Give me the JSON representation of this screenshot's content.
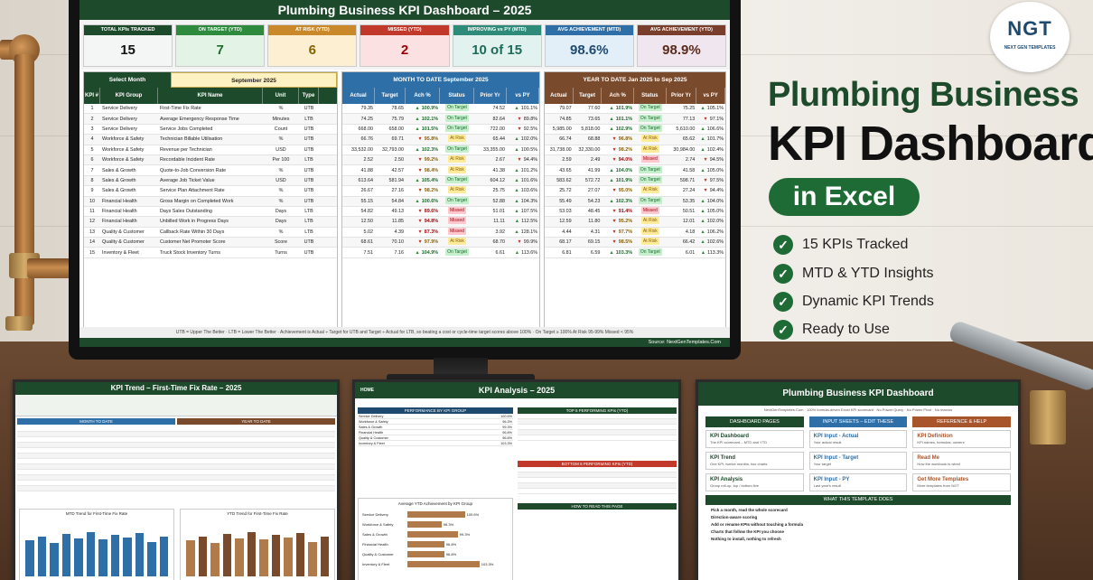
{
  "hero": {
    "line1": "Plumbing Business",
    "line2": "KPI Dashboard",
    "line3": "in Excel",
    "features": [
      "15 KPIs Tracked",
      "MTD & YTD Insights",
      "Dynamic KPI Trends",
      "Ready to Use"
    ]
  },
  "logo": {
    "mark": "NGT",
    "text": "NEXT GEN TEMPLATES"
  },
  "dashboard": {
    "title": "Plumbing Business KPI Dashboard  –  2025",
    "cards": [
      {
        "label": "TOTAL KPIs TRACKED",
        "value": "15",
        "head": "#1e4a2c",
        "bg": "#f3f6f4",
        "fg": "#111"
      },
      {
        "label": "ON TARGET (YTD)",
        "value": "7",
        "head": "#2e8b3e",
        "bg": "#e3f3e6",
        "fg": "#1e6b2d"
      },
      {
        "label": "AT RISK (YTD)",
        "value": "6",
        "head": "#c9892a",
        "bg": "#fdf0d2",
        "fg": "#8a6100"
      },
      {
        "label": "MISSED (YTD)",
        "value": "2",
        "head": "#c0392b",
        "bg": "#fbe1e1",
        "fg": "#9c0006"
      },
      {
        "label": "IMPROVING vs PY (MTD)",
        "value": "10 of 15",
        "head": "#2e8b7a",
        "bg": "#e2f2ee",
        "fg": "#1e6b5c"
      },
      {
        "label": "AVG ACHIEVEMENT (MTD)",
        "value": "98.6%",
        "head": "#2f6fa8",
        "bg": "#e2eef8",
        "fg": "#1e4a70"
      },
      {
        "label": "AVG ACHIEVEMENT (YTD)",
        "value": "98.9%",
        "head": "#7a3f2c",
        "bg": "#efe6ef",
        "fg": "#5a2a1a"
      }
    ],
    "select_month_label": "Select Month",
    "select_month_value": "September 2025",
    "mtd_header": "MONTH TO DATE   September 2025",
    "ytd_header": "YEAR TO DATE   Jan 2025  to  Sep 2025",
    "left_cols": [
      "KPI #",
      "KPI Group",
      "KPI Name",
      "Unit",
      "Type"
    ],
    "metric_cols": [
      "Actual",
      "Target",
      "Ach %",
      "Status",
      "Prior Yr",
      "vs PY"
    ],
    "rows": [
      {
        "n": "1",
        "g": "Service Delivery",
        "k": "First-Time Fix Rate",
        "u": "%",
        "t": "UTB",
        "m": [
          "79.35",
          "78.65",
          "100.9%",
          "On Target",
          "74.52",
          "101.1%"
        ],
        "ms": "on",
        "md": "up",
        "my": "up",
        "y": [
          "79.07",
          "77.60",
          "101.9%",
          "On Target",
          "75.25",
          "105.1%"
        ],
        "ys": "on",
        "yd": "up",
        "yy": "up"
      },
      {
        "n": "2",
        "g": "Service Delivery",
        "k": "Average Emergency Response Time",
        "u": "Minutes",
        "t": "LTB",
        "m": [
          "74.25",
          "75.79",
          "102.1%",
          "On Target",
          "82.64",
          "89.8%"
        ],
        "ms": "on",
        "md": "up",
        "my": "dn",
        "y": [
          "74.85",
          "73.65",
          "101.1%",
          "On Target",
          "77.13",
          "97.1%"
        ],
        "ys": "on",
        "yd": "up",
        "yy": "dn"
      },
      {
        "n": "3",
        "g": "Service Delivery",
        "k": "Service Jobs Completed",
        "u": "Count",
        "t": "UTB",
        "m": [
          "668.00",
          "658.00",
          "101.5%",
          "On Target",
          "722.00",
          "92.5%"
        ],
        "ms": "on",
        "md": "up",
        "my": "dn",
        "y": [
          "5,985.00",
          "5,818.00",
          "102.9%",
          "On Target",
          "5,610.00",
          "106.6%"
        ],
        "ys": "on",
        "yd": "up",
        "yy": "up"
      },
      {
        "n": "4",
        "g": "Workforce & Safety",
        "k": "Technician Billable Utilisation",
        "u": "%",
        "t": "UTB",
        "m": [
          "66.76",
          "69.71",
          "95.8%",
          "At Risk",
          "65.44",
          "102.0%"
        ],
        "ms": "risk",
        "md": "dn",
        "my": "up",
        "y": [
          "66.74",
          "68.88",
          "96.8%",
          "At Risk",
          "65.62",
          "101.7%"
        ],
        "ys": "risk",
        "yd": "dn",
        "yy": "up"
      },
      {
        "n": "5",
        "g": "Workforce & Safety",
        "k": "Revenue per Technician",
        "u": "USD",
        "t": "UTB",
        "m": [
          "33,532.00",
          "32,793.00",
          "102.3%",
          "On Target",
          "33,355.00",
          "100.5%"
        ],
        "ms": "on",
        "md": "up",
        "my": "up",
        "y": [
          "31,738.00",
          "32,330.00",
          "98.2%",
          "At Risk",
          "30,984.00",
          "102.4%"
        ],
        "ys": "risk",
        "yd": "dn",
        "yy": "up"
      },
      {
        "n": "6",
        "g": "Workforce & Safety",
        "k": "Recordable Incident Rate",
        "u": "Per 100",
        "t": "LTB",
        "m": [
          "2.52",
          "2.50",
          "99.2%",
          "At Risk",
          "2.67",
          "94.4%"
        ],
        "ms": "risk",
        "md": "dn",
        "my": "dn",
        "y": [
          "2.59",
          "2.49",
          "94.0%",
          "Missed",
          "2.74",
          "94.5%"
        ],
        "ys": "miss",
        "yd": "dn",
        "yy": "dn"
      },
      {
        "n": "7",
        "g": "Sales & Growth",
        "k": "Quote-to-Job Conversion Rate",
        "u": "%",
        "t": "UTB",
        "m": [
          "41.88",
          "42.57",
          "98.4%",
          "At Risk",
          "41.38",
          "101.2%"
        ],
        "ms": "risk",
        "md": "dn",
        "my": "up",
        "y": [
          "43.65",
          "41.99",
          "104.0%",
          "On Target",
          "41.58",
          "105.0%"
        ],
        "ys": "on",
        "yd": "up",
        "yy": "up"
      },
      {
        "n": "8",
        "g": "Sales & Growth",
        "k": "Average Job Ticket Value",
        "u": "USD",
        "t": "UTB",
        "m": [
          "613.64",
          "581.94",
          "105.4%",
          "On Target",
          "604.12",
          "101.6%"
        ],
        "ms": "on",
        "md": "up",
        "my": "up",
        "y": [
          "583.62",
          "572.72",
          "101.9%",
          "On Target",
          "598.71",
          "97.5%"
        ],
        "ys": "on",
        "yd": "up",
        "yy": "dn"
      },
      {
        "n": "9",
        "g": "Sales & Growth",
        "k": "Service Plan Attachment Rate",
        "u": "%",
        "t": "UTB",
        "m": [
          "26.67",
          "27.16",
          "98.2%",
          "At Risk",
          "25.75",
          "103.6%"
        ],
        "ms": "risk",
        "md": "dn",
        "my": "up",
        "y": [
          "25.72",
          "27.07",
          "95.0%",
          "At Risk",
          "27.24",
          "94.4%"
        ],
        "ys": "risk",
        "yd": "dn",
        "yy": "dn"
      },
      {
        "n": "10",
        "g": "Financial Health",
        "k": "Gross Margin on Completed Work",
        "u": "%",
        "t": "UTB",
        "m": [
          "55.15",
          "54.84",
          "100.6%",
          "On Target",
          "52.88",
          "104.3%"
        ],
        "ms": "on",
        "md": "up",
        "my": "up",
        "y": [
          "55.49",
          "54.23",
          "102.3%",
          "On Target",
          "53.35",
          "104.0%"
        ],
        "ys": "on",
        "yd": "up",
        "yy": "up"
      },
      {
        "n": "11",
        "g": "Financial Health",
        "k": "Days Sales Outstanding",
        "u": "Days",
        "t": "LTB",
        "m": [
          "54.82",
          "49.13",
          "89.6%",
          "Missed",
          "51.01",
          "107.5%"
        ],
        "ms": "miss",
        "md": "dn",
        "my": "up",
        "y": [
          "53.03",
          "48.45",
          "91.4%",
          "Missed",
          "50.51",
          "105.0%"
        ],
        "ys": "miss",
        "yd": "dn",
        "yy": "up"
      },
      {
        "n": "12",
        "g": "Financial Health",
        "k": "Unbilled Work in Progress Days",
        "u": "Days",
        "t": "LTB",
        "m": [
          "12.50",
          "11.85",
          "94.8%",
          "Missed",
          "11.11",
          "112.5%"
        ],
        "ms": "miss",
        "md": "dn",
        "my": "up",
        "y": [
          "12.59",
          "11.80",
          "95.2%",
          "At Risk",
          "12.01",
          "102.0%"
        ],
        "ys": "risk",
        "yd": "dn",
        "yy": "up"
      },
      {
        "n": "13",
        "g": "Quality & Customer",
        "k": "Callback Rate Within 30 Days",
        "u": "%",
        "t": "LTB",
        "m": [
          "5.02",
          "4.39",
          "87.3%",
          "Missed",
          "3.92",
          "128.1%"
        ],
        "ms": "miss",
        "md": "dn",
        "my": "up",
        "y": [
          "4.44",
          "4.31",
          "97.7%",
          "At Risk",
          "4.18",
          "106.2%"
        ],
        "ys": "risk",
        "yd": "dn",
        "yy": "up"
      },
      {
        "n": "14",
        "g": "Quality & Customer",
        "k": "Customer Net Promoter Score",
        "u": "Score",
        "t": "UTB",
        "m": [
          "68.61",
          "70.10",
          "97.9%",
          "At Risk",
          "68.70",
          "99.9%"
        ],
        "ms": "risk",
        "md": "dn",
        "my": "dn",
        "y": [
          "68.17",
          "69.15",
          "98.5%",
          "At Risk",
          "66.42",
          "102.6%"
        ],
        "ys": "risk",
        "yd": "dn",
        "yy": "up"
      },
      {
        "n": "15",
        "g": "Inventory & Fleet",
        "k": "Truck Stock Inventory Turns",
        "u": "Turns",
        "t": "UTB",
        "m": [
          "7.51",
          "7.16",
          "104.9%",
          "On Target",
          "6.61",
          "113.6%"
        ],
        "ms": "on",
        "md": "up",
        "my": "up",
        "y": [
          "6.81",
          "6.59",
          "103.3%",
          "On Target",
          "6.01",
          "113.3%"
        ],
        "ys": "on",
        "yd": "up",
        "yy": "up"
      }
    ],
    "legend": "UTB = Upper The Better   ·   LTB = Lower The Better   ·   Achievement is Actual ÷ Target for UTB and Target ÷ Actual for LTB, so beating a cost or cycle-time target scores above 100%   ·   On Target ≥ 100%   At Risk 95-99%   Missed < 95%",
    "source": "Source: NextGenTemplates.Com"
  },
  "thumb_trend": {
    "title": "KPI Trend  –  First-Time Fix Rate  –  2025",
    "chart1": "MTD Trend for First-Time Fix Rate",
    "chart2": "YTD Trend for First-Time Fix Rate",
    "month_header": "MONTH TO DATE",
    "ytd_header": "YEAR TO DATE"
  },
  "thumb_analysis": {
    "title": "KPI Analysis  –  2025",
    "home": "HOME",
    "perf_header": "PERFORMANCE BY KPI GROUP",
    "top_header": "TOP 5 PERFORMING KPIs (YTD)",
    "bottom_header": "BOTTOM 5 PERFORMING KPIs (YTD)",
    "chart_title": "Average YTD Achievement by KPI Group",
    "how_header": "HOW TO READ THIS PAGE",
    "groups": [
      "Service Delivery",
      "Workforce & Safety",
      "Sales & Growth",
      "Financial Health",
      "Quality & Customer",
      "Inventory & Fleet"
    ],
    "group_ach": [
      "100.6%",
      "96.3%",
      "99.3%",
      "96.8%",
      "96.8%",
      "103.3%"
    ]
  },
  "thumb_nav": {
    "title": "Plumbing Business KPI Dashboard",
    "sub": "NextGenTemplates.Com  ·  100% formula-driven Excel KPI scorecard  ·  No Power Query  ·  No Power Pivot  ·  No macros",
    "col1": "DASHBOARD PAGES",
    "col2": "INPUT SHEETS – EDIT THESE",
    "col3": "REFERENCE & HELP",
    "items": [
      {
        "t": "KPI Dashboard",
        "d": "The KPI scorecard – MTD and YTD"
      },
      {
        "t": "KPI Input - Actual",
        "d": "Your actual result"
      },
      {
        "t": "KPI Definition",
        "d": "KPI names, formulas, owners"
      },
      {
        "t": "KPI Trend",
        "d": "One KPI, twelve months, two charts"
      },
      {
        "t": "KPI Input - Target",
        "d": "Your target"
      },
      {
        "t": "Read Me",
        "d": "How the workbook is wired"
      },
      {
        "t": "KPI Analysis",
        "d": "Group roll-up, top / bottom five"
      },
      {
        "t": "KPI Input - PY",
        "d": "Last year's result"
      },
      {
        "t": "Get More Templates",
        "d": "More templates from NGT"
      }
    ],
    "what_header": "WHAT THIS TEMPLATE DOES",
    "what": [
      "Pick a month, read the whole scorecard",
      "Direction-aware scoring",
      "Add or rename KPIs without touching a formula",
      "Charts that follow the KPI you choose",
      "Nothing to install, nothing to refresh"
    ]
  }
}
